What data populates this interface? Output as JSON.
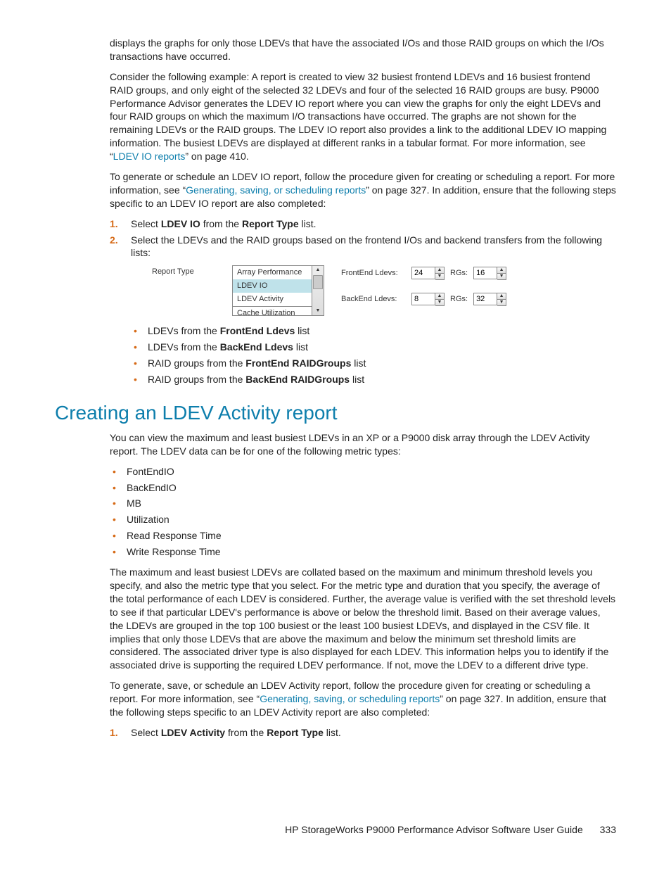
{
  "p1": "displays the graphs for only those LDEVs that have the associated I/Os and those RAID groups on which the I/Os transactions have occurred.",
  "p2a": "Consider the following example: A report is created to view 32 busiest frontend LDEVs and 16 busiest frontend RAID groups, and only eight of the selected 32 LDEVs and four of the selected 16 RAID groups are busy. P9000 Performance Advisor generates the LDEV IO report where you can view the graphs for only the eight LDEVs and four RAID groups on which the maximum I/O transactions have occurred. The graphs are not shown for the remaining LDEVs or the RAID groups. The LDEV IO report also provides a link to the additional LDEV IO mapping information. The busiest LDEVs are displayed at different ranks in a tabular format. For more information, see “",
  "p2link": "LDEV IO reports",
  "p2b": "” on page 410.",
  "p3a": "To generate or schedule an LDEV IO report, follow the procedure given for creating or scheduling a report. For more information, see “",
  "p3link": "Generating, saving, or scheduling reports",
  "p3b": "” on page 327. In addition, ensure that the following steps specific to an LDEV IO report are also completed:",
  "step1": {
    "num": "1.",
    "a": "Select ",
    "b1": "LDEV IO",
    "b": " from the ",
    "b2": "Report Type",
    "c": " list."
  },
  "step2": {
    "num": "2.",
    "text": "Select the LDEVs and the RAID groups based on the frontend I/Os and backend transfers from the following lists:"
  },
  "ui": {
    "reportTypeLabel": "Report Type",
    "options": [
      "Array Performance",
      "LDEV IO",
      "LDEV Activity",
      "Cache Utilization"
    ],
    "feLdevs": "FrontEnd Ldevs:",
    "beLdevs": "BackEnd Ldevs:",
    "rgs": "RGs:",
    "v_fe": "24",
    "v_fe_rg": "16",
    "v_be": "8",
    "v_be_rg": "32"
  },
  "sub": {
    "i1a": "LDEVs from the ",
    "i1b": "FrontEnd Ldevs",
    "i1c": " list",
    "i2a": "LDEVs from the ",
    "i2b": "BackEnd Ldevs",
    "i2c": " list",
    "i3a": "RAID groups from the ",
    "i3b": "FrontEnd RAIDGroups",
    "i3c": " list",
    "i4a": "RAID groups from the ",
    "i4b": "BackEnd RAIDGroups",
    "i4c": " list"
  },
  "h2": "Creating an LDEV Activity report",
  "p4": "You can view the maximum and least busiest LDEVs in an XP or a P9000 disk array through the LDEV Activity report. The LDEV data can be for one of the following metric types:",
  "metrics": [
    "FontEndIO",
    "BackEndIO",
    "MB",
    "Utilization",
    "Read Response Time",
    "Write Response Time"
  ],
  "p5": "The maximum and least busiest LDEVs are collated based on the maximum and minimum threshold levels you specify, and also the metric type that you select. For the metric type and duration that you specify, the average of the total performance of each LDEV is considered. Further, the average value is verified with the set threshold levels to see if that particular LDEV's performance is above or below the threshold limit. Based on their average values, the LDEVs are grouped in the top 100 busiest or the least 100 busiest LDEVs, and displayed in the CSV file. It implies that only those LDEVs that are above the maximum and below the minimum set threshold limits are considered. The associated driver type is also displayed for each LDEV. This information helps you to identify if the associated drive is supporting the required LDEV performance. If not, move the LDEV to a different drive type.",
  "p6a": "To generate, save, or schedule an LDEV Activity report, follow the procedure given for creating or scheduling a report. For more information, see “",
  "p6link": "Generating, saving, or scheduling reports",
  "p6b": "” on page 327. In addition, ensure that the following steps specific to an LDEV Activity report are also completed:",
  "step1b": {
    "num": "1.",
    "a": "Select ",
    "b1": "LDEV Activity",
    "b": " from the ",
    "b2": "Report Type",
    "c": " list."
  },
  "footer": {
    "title": "HP StorageWorks P9000 Performance Advisor Software User Guide",
    "page": "333"
  }
}
